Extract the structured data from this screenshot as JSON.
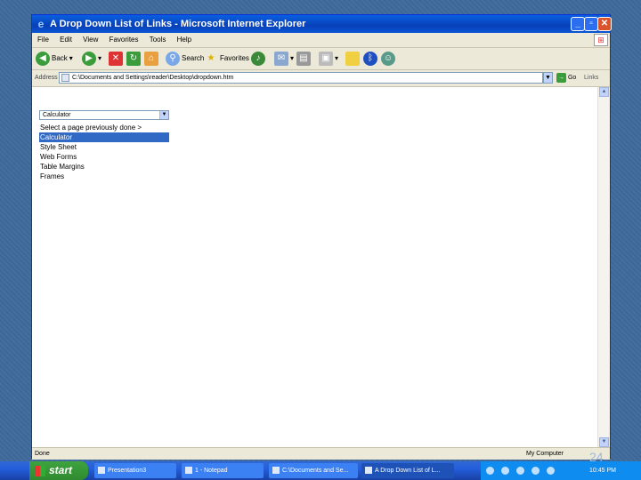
{
  "window": {
    "title": "A Drop Down List of Links - Microsoft Internet Explorer"
  },
  "menu": {
    "items": [
      "File",
      "Edit",
      "View",
      "Favorites",
      "Tools",
      "Help"
    ]
  },
  "toolbar": {
    "back_label": "Back",
    "search_label": "Search",
    "favorites_label": "Favorites"
  },
  "address": {
    "label": "Address",
    "value": "C:\\Documents and Settings\\reader\\Desktop\\dropdown.htm",
    "go_label": "Go",
    "links_label": "Links"
  },
  "page": {
    "select_value": "Calculator",
    "options": [
      "Select a page previously done  >",
      "Calculator",
      "Style Sheet",
      "Web Forms",
      "Table Margins",
      "Frames"
    ],
    "selected_index": 1
  },
  "status": {
    "left": "Done",
    "zone": "My Computer"
  },
  "taskbar": {
    "start": "start",
    "tasks": [
      "Presentation3",
      "1 - Notepad",
      "C:\\Documents and Se...",
      "A Drop Down List of L..."
    ],
    "clock": "10:45 PM"
  },
  "slide": {
    "page_number": "24"
  }
}
